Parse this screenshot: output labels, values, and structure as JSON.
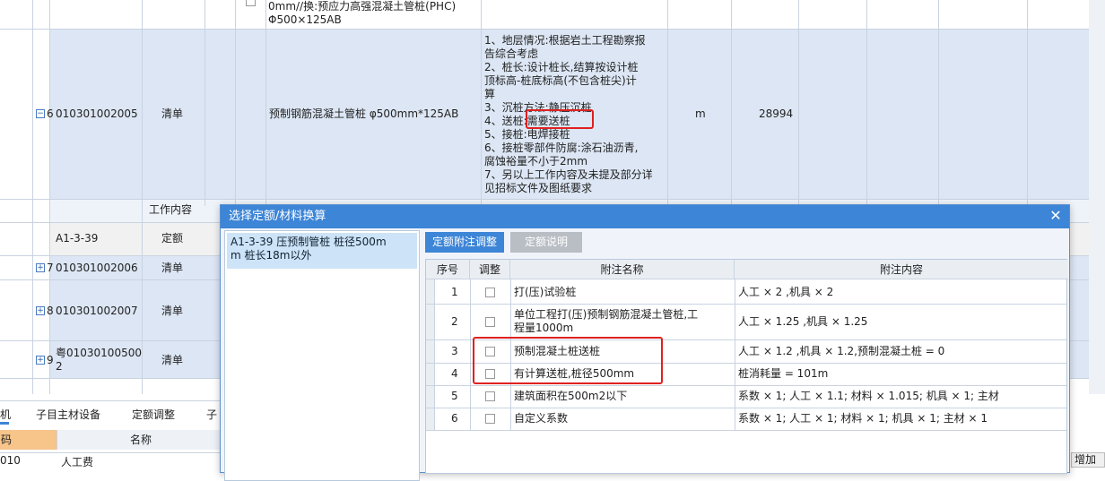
{
  "main_rows": {
    "top_partial": {
      "text1": "0mm//换:预应力高强混凝土管桩(PHC)",
      "text2": "Φ500×125AB"
    },
    "r1": {
      "seq": "6",
      "code": "010301002005",
      "type": "清单",
      "name": "预制钢筋混凝土管桩 φ500mm*125AB",
      "features": [
        "1、地层情况:根据岩土工程勘察报",
        "告综合考虑",
        "2、桩长:设计桩长,结算按设计桩",
        "顶标高-桩底标高(不包含桩尖)计",
        "算",
        "3、沉桩方法:静压沉桩",
        "4、送桩:需要送桩",
        "5、接桩:电焊接桩",
        "6、接桩零部件防腐:涂石油沥青,",
        "腐蚀裕量不小于2mm",
        "7、另以上工作内容及未提及部分详",
        "见招标文件及图纸要求"
      ],
      "unit": "m",
      "qty": "28994"
    },
    "work_content": "工作内容",
    "r2": {
      "code": "A1-3-39",
      "type": "定额"
    },
    "r3": {
      "seq": "7",
      "code": "010301002006",
      "type": "清单"
    },
    "r4": {
      "seq": "8",
      "code": "010301002007",
      "type": "清单"
    },
    "r5": {
      "seq": "9",
      "code1": "粤01030100500",
      "code2": "2",
      "type": "清单"
    }
  },
  "bottom_tabs": [
    "机",
    "子目主材设备",
    "定额调整",
    "子"
  ],
  "bottom_head": {
    "col1": "码",
    "col2": "名称"
  },
  "bottom_row": {
    "code": "010",
    "name": "人工费"
  },
  "right_edge_label": "增加",
  "dialog": {
    "title": "选择定额/材料换算",
    "left_item": {
      "line1": "A1-3-39  压预制管桩 桩径500m",
      "line2": "m 桩长18m以外"
    },
    "tabs": [
      "定额附注调整",
      "定额说明"
    ],
    "columns": [
      "序号",
      "调整",
      "附注名称",
      "附注内容"
    ],
    "rows": [
      {
        "no": "1",
        "name": "打(压)试验桩",
        "content": "人工 × 2 ,机具 × 2"
      },
      {
        "no": "2",
        "name": "单位工程打(压)预制钢筋混凝土管桩,工",
        "name2": "程量1000m",
        "content": "人工 × 1.25 ,机具 × 1.25"
      },
      {
        "no": "3",
        "name": "预制混凝土桩送桩",
        "content": "人工 × 1.2 ,机具 × 1.2,预制混凝土桩 = 0"
      },
      {
        "no": "4",
        "name": "有计算送桩,桩径500mm",
        "content": "桩消耗量 = 101m"
      },
      {
        "no": "5",
        "name": "建筑面积在500m2以下",
        "content": "系数 × 1; 人工 × 1.1; 材料 × 1.015; 机具 × 1; 主材"
      },
      {
        "no": "6",
        "name": "自定义系数",
        "content": "系数 × 1; 人工 × 1; 材料 × 1; 机具 × 1; 主材 × 1"
      }
    ]
  },
  "colors": {
    "title_bar": "#3d85d6",
    "row_blue": "#dce6f4",
    "highlight": "#e02020"
  }
}
